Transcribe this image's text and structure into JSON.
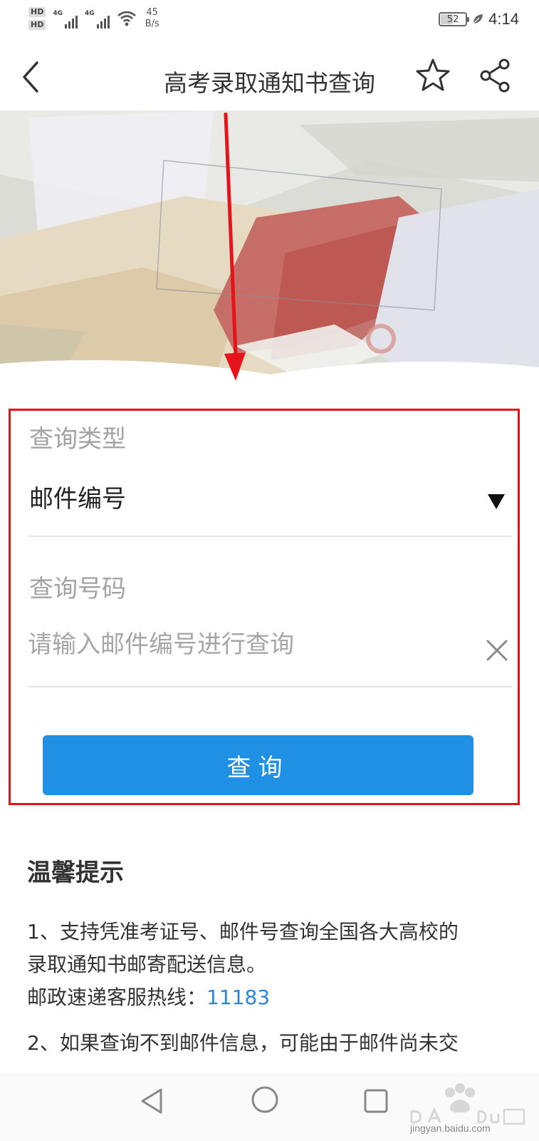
{
  "status_bar": {
    "sim1": "HD",
    "sim2": "HD",
    "net1": "4G",
    "net2": "4G",
    "speed_value": "45",
    "speed_unit": "B/s",
    "battery": "52",
    "battery_level": 52,
    "time": "4:14"
  },
  "header": {
    "title": "高考录取通知书查询",
    "icons": [
      "back-icon",
      "star-icon",
      "share-icon"
    ]
  },
  "form": {
    "type_label": "查询类型",
    "type_value": "邮件编号",
    "number_label": "查询号码",
    "number_placeholder": "请输入邮件编号进行查询",
    "number_value": "",
    "submit_label": "查询"
  },
  "tips": {
    "title": "温馨提示",
    "item1_line1": "1、支持凭准考证号、邮件号查询全国各大高校的",
    "item1_line2": "录取通知书邮寄配送信息。",
    "hotline_label": "邮政速递客服热线：",
    "hotline_number": "11183",
    "item2_line1": "2、如果查询不到邮件信息，可能由于邮件尚未交"
  },
  "nav_bar": {
    "icons": [
      "nav-back-icon",
      "nav-home-icon",
      "nav-recent-icon"
    ]
  },
  "watermark": {
    "text": "jingyan.baidu.com"
  },
  "colors": {
    "accent": "#1f90e4",
    "annotation": "#e5141a",
    "link": "#2b86d8"
  }
}
